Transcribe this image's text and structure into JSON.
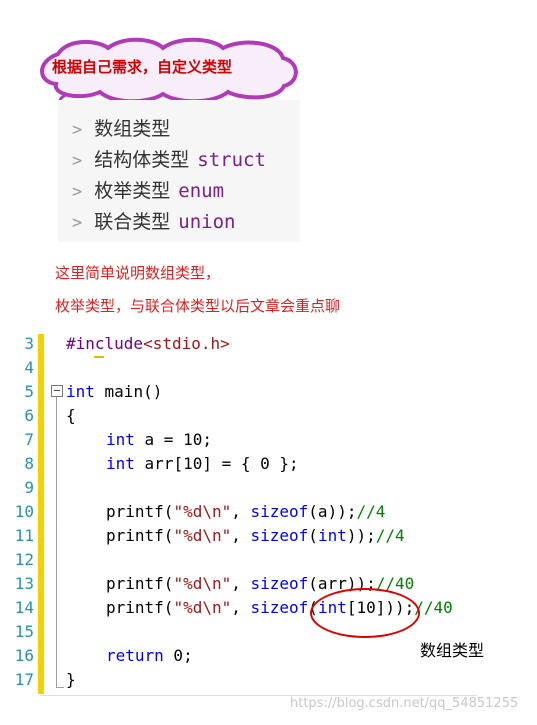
{
  "callout": {
    "text": "根据自己需求，自定义类型"
  },
  "type_list": [
    {
      "label": "数组类型",
      "keyword": ""
    },
    {
      "label": "结构体类型",
      "keyword": "struct"
    },
    {
      "label": "枚举类型",
      "keyword": "enum"
    },
    {
      "label": "联合类型",
      "keyword": "union"
    }
  ],
  "list_arrow": ">",
  "notes": [
    "这里简单说明数组类型，",
    "枚举类型，与联合体类型以后文章会重点聊"
  ],
  "code": {
    "line_numbers": [
      "3",
      "4",
      "5",
      "6",
      "7",
      "8",
      "9",
      "10",
      "11",
      "12",
      "13",
      "14",
      "15",
      "16",
      "17"
    ],
    "lines": {
      "l3_pre": "#include",
      "l3_inc": "<stdio.h>",
      "l5_kw": "int",
      "l5_rest": " main()",
      "l6": "{",
      "l7_kw": "int",
      "l7_rest": " a = 10;",
      "l8_kw": "int",
      "l8_rest": " arr[10] = { 0 };",
      "l10_a": "printf(",
      "l10_str": "\"%d\\n\"",
      "l10_b": ", ",
      "l10_sz": "sizeof",
      "l10_c": "(a));",
      "l10_cm": "//4",
      "l11_a": "printf(",
      "l11_str": "\"%d\\n\"",
      "l11_b": ", ",
      "l11_sz": "sizeof",
      "l11_c": "(",
      "l11_kw": "int",
      "l11_d": "));",
      "l11_cm": "//4",
      "l13_a": "printf(",
      "l13_str": "\"%d\\n\"",
      "l13_b": ", ",
      "l13_sz": "sizeof",
      "l13_c": "(arr));",
      "l13_cm": "//40",
      "l14_a": "printf(",
      "l14_str": "\"%d\\n\"",
      "l14_b": ", ",
      "l14_sz": "sizeof",
      "l14_c": "(",
      "l14_kw": "int",
      "l14_d": "[10]));",
      "l14_cm": "//40",
      "l16_kw": "return",
      "l16_rest": " 0;",
      "l17": "}"
    }
  },
  "annotation": "数组类型",
  "watermark": "https://blog.csdn.net/qq_54851255",
  "colors": {
    "keyword": "#0000ff",
    "preprocessor": "#6f008a",
    "string": "#a31515",
    "comment": "#008000",
    "line_number": "#2b91af",
    "callout_text": "#d40000",
    "note_text": "#e02020",
    "highlight_bar": "#f3d200"
  }
}
